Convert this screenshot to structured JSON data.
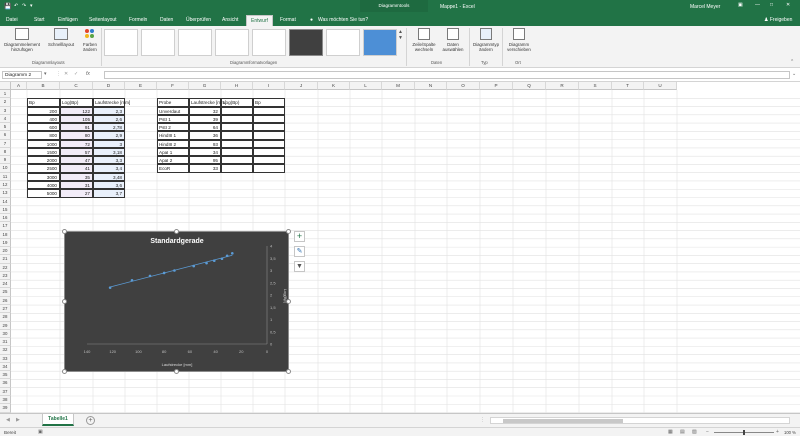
{
  "titlebar": {
    "save_icon": "save-icon",
    "context_label": "Diagrammtools",
    "doc_title": "Mappe1 - Excel",
    "user": "Marcel Meyer"
  },
  "tabs": [
    "Datei",
    "Start",
    "Einfügen",
    "Seitenlayout",
    "Formeln",
    "Daten",
    "Überprüfen",
    "Ansicht",
    "Entwurf",
    "Format"
  ],
  "active_tab": "Entwurf",
  "tell_me": "Was möchten Sie tun?",
  "share": "Freigeben",
  "ribbon": {
    "add_element": "Diagrammelement hinzufügen",
    "quick_layout": "Schnelllayout",
    "change_colors": "Farben ändern",
    "switch_rowcol": "Zeile/Spalte wechseln",
    "select_data": "Daten auswählen",
    "change_type": "Diagrammtyp ändern",
    "move_chart": "Diagramm verschieben",
    "groups": {
      "layouts": "Diagrammlayouts",
      "styles": "Diagrammformatvorlagen",
      "data": "Daten",
      "type": "Typ",
      "location": "Ort"
    }
  },
  "namebox": "Diagramm 2",
  "fx": "fx",
  "columns": [
    "A",
    "B",
    "C",
    "D",
    "E",
    "F",
    "G",
    "H",
    "I",
    "J",
    "K",
    "L",
    "M",
    "N",
    "O",
    "P",
    "Q",
    "R",
    "S",
    "T",
    "U"
  ],
  "rows": [
    "1",
    "2",
    "3",
    "4",
    "5",
    "6",
    "7",
    "8",
    "9",
    "10",
    "11",
    "12",
    "13",
    "14",
    "15",
    "16",
    "17",
    "18",
    "19",
    "20",
    "21",
    "22",
    "23",
    "24",
    "25",
    "26",
    "27",
    "28",
    "29",
    "30",
    "31",
    "32",
    "33",
    "34",
    "35",
    "36",
    "37",
    "38",
    "39"
  ],
  "table1": {
    "headers": [
      "Bp",
      "Log(Bp)",
      "Laufstrecke [mm]"
    ],
    "rows": [
      [
        "200",
        "122",
        "2,3"
      ],
      [
        "400",
        "105",
        "2,6"
      ],
      [
        "600",
        "91",
        "2,78"
      ],
      [
        "800",
        "80",
        "2,9"
      ],
      [
        "1000",
        "72",
        "3"
      ],
      [
        "1500",
        "57",
        "3,18"
      ],
      [
        "2000",
        "47",
        "3,3"
      ],
      [
        "2500",
        "41",
        "3,4"
      ],
      [
        "3000",
        "35",
        "3,48"
      ],
      [
        "4000",
        "31",
        "3,6"
      ],
      [
        "5000",
        "27",
        "3,7"
      ]
    ]
  },
  "table2": {
    "headers": [
      "Probe",
      "Laufstrecke [mm]",
      "Log(Bp)",
      "Bp"
    ],
    "rows": [
      [
        "Unverdaut",
        "32"
      ],
      [
        "PstI 1",
        "39"
      ],
      [
        "PstI 2",
        "64"
      ],
      [
        "HindIII 1",
        "36"
      ],
      [
        "HindIII 2",
        "93"
      ],
      [
        "ApaI 1",
        "34"
      ],
      [
        "ApaI 2",
        "95"
      ],
      [
        "EcoR",
        "33"
      ]
    ]
  },
  "chart_data": {
    "type": "scatter",
    "title": "Standardgerade",
    "xlabel": "Laufstrecke [mm]",
    "ylabel": "Log(Bp)",
    "x_ticks": [
      "140",
      "120",
      "100",
      "80",
      "60",
      "40",
      "20",
      "0"
    ],
    "y_ticks": [
      "0",
      "0,5",
      "1",
      "1,5",
      "2",
      "2,5",
      "3",
      "3,5",
      "4"
    ],
    "x_reversed": true,
    "y_axis_position": "right",
    "xlim": [
      0,
      140
    ],
    "ylim": [
      0,
      4
    ],
    "trendline": true,
    "points": [
      {
        "x": 122,
        "y": 2.3
      },
      {
        "x": 105,
        "y": 2.6
      },
      {
        "x": 91,
        "y": 2.78
      },
      {
        "x": 80,
        "y": 2.9
      },
      {
        "x": 72,
        "y": 3
      },
      {
        "x": 57,
        "y": 3.18
      },
      {
        "x": 47,
        "y": 3.3
      },
      {
        "x": 41,
        "y": 3.4
      },
      {
        "x": 35,
        "y": 3.48
      },
      {
        "x": 31,
        "y": 3.6
      },
      {
        "x": 27,
        "y": 3.7
      }
    ]
  },
  "sheet_tab": "Tabelle1",
  "status": {
    "ready": "Bereit",
    "zoom": "100 %"
  }
}
